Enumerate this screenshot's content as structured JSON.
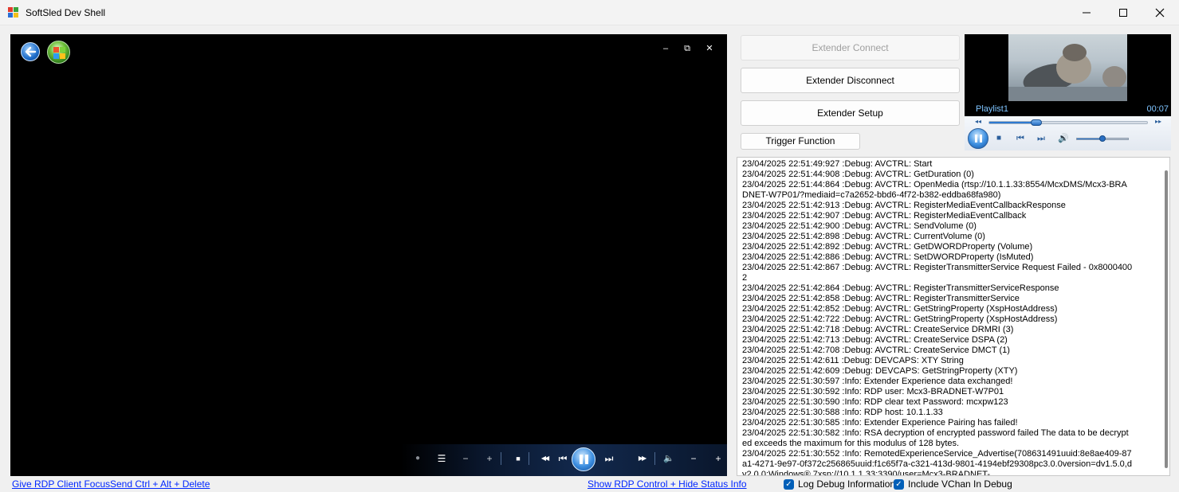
{
  "window": {
    "title": "SoftSled Dev Shell",
    "minimize_glyph": "─",
    "maximize_glyph": "☐",
    "close_glyph": "✕"
  },
  "media_center": {
    "window_controls": {
      "minimize": "‒",
      "restore": "⧉",
      "close": "✕"
    },
    "transport": {
      "record": "●",
      "guide": "☰",
      "channel_down": "−",
      "channel_up": "+",
      "stop": "■",
      "rewind": "◀◀",
      "prev": "⏮",
      "next": "⏭",
      "fast_forward": "▶▶",
      "mute": "🔈",
      "volume_down": "−",
      "volume_up": "+"
    }
  },
  "links": {
    "give_focus": "Give RDP Client Focus",
    "send_cad": "Send Ctrl + Alt + Delete",
    "show_rdp": "Show RDP Control + Hide Status Info"
  },
  "buttons": {
    "connect": "Extender Connect",
    "disconnect": "Extender Disconnect",
    "setup": "Extender Setup",
    "trigger": "Trigger Function"
  },
  "player": {
    "playlist": "Playlist1",
    "time": "00:07",
    "seek_progress": 0.3,
    "volume_level": 0.5,
    "icons": {
      "rewind": "◂◂",
      "forward": "▸▸",
      "stop": "■",
      "prev": "⏮",
      "next": "⏭",
      "volume": "🔊"
    }
  },
  "log_lines": [
    "23/04/2025 22:51:49:927 :Debug: AVCTRL: Start",
    "23/04/2025 22:51:44:908 :Debug: AVCTRL: GetDuration (0)",
    "23/04/2025 22:51:44:864 :Debug: AVCTRL: OpenMedia (rtsp://10.1.1.33:8554/McxDMS/Mcx3-BRADNET-W7P01/?mediaid=c7a2652-bbd6-4f72-b382-eddba68fa980)",
    "23/04/2025 22:51:42:913 :Debug: AVCTRL: RegisterMediaEventCallbackResponse",
    "23/04/2025 22:51:42:907 :Debug: AVCTRL: RegisterMediaEventCallback",
    "23/04/2025 22:51:42:900 :Debug: AVCTRL: SendVolume (0)",
    "23/04/2025 22:51:42:898 :Debug: AVCTRL: CurrentVolume (0)",
    "23/04/2025 22:51:42:892 :Debug: AVCTRL: GetDWORDProperty (Volume)",
    "23/04/2025 22:51:42:886 :Debug: AVCTRL: SetDWORDProperty (IsMuted)",
    "23/04/2025 22:51:42:867 :Debug: AVCTRL: RegisterTransmitterService Request Failed - 0x80004002",
    "23/04/2025 22:51:42:864 :Debug: AVCTRL: RegisterTransmitterServiceResponse",
    "23/04/2025 22:51:42:858 :Debug: AVCTRL: RegisterTransmitterService",
    "23/04/2025 22:51:42:852 :Debug: AVCTRL: GetStringProperty (XspHostAddress)",
    "23/04/2025 22:51:42:722 :Debug: AVCTRL: GetStringProperty (XspHostAddress)",
    "23/04/2025 22:51:42:718 :Debug: AVCTRL: CreateService DRMRI (3)",
    "23/04/2025 22:51:42:713 :Debug: AVCTRL: CreateService DSPA (2)",
    "23/04/2025 22:51:42:708 :Debug: AVCTRL: CreateService DMCT  (1)",
    "23/04/2025 22:51:42:611 :Debug: DEVCAPS: XTY String",
    "23/04/2025 22:51:42:609 :Debug: DEVCAPS: GetStringProperty (XTY)",
    "23/04/2025 22:51:30:597 :Info: Extender Experience data exchanged!",
    "23/04/2025 22:51:30:592 :Info: RDP user: Mcx3-BRADNET-W7P01",
    "23/04/2025 22:51:30:590 :Info: RDP clear text Password: mcxpw123",
    "23/04/2025 22:51:30:588 :Info: RDP host: 10.1.1.33",
    "23/04/2025 22:51:30:585 :Info: Extender Experience Pairing has failed!",
    "23/04/2025 22:51:30:582 :Info: RSA decryption of encrypted password failed The data to be decrypted exceeds the maximum for this modulus of 128 bytes.",
    "23/04/2025 22:51:30:552 :Info: RemotedExperienceService_Advertise(708631491uuid:8e8ae409-87a1-4271-9e97-0f372c256865uuid:f1c65f7a-c321-413d-9801-4194ebf29308pc3.0.0version=dv1.5.0,dv2.0.0;Windows® 7xsp://10.1.1.33:3390/user=Mcx3-BRADNET-"
  ],
  "checkboxes": {
    "log_debug": {
      "label": "Log Debug Information",
      "checked": true
    },
    "include_vchan": {
      "label": "Include VChan In Debug",
      "checked": true
    }
  }
}
